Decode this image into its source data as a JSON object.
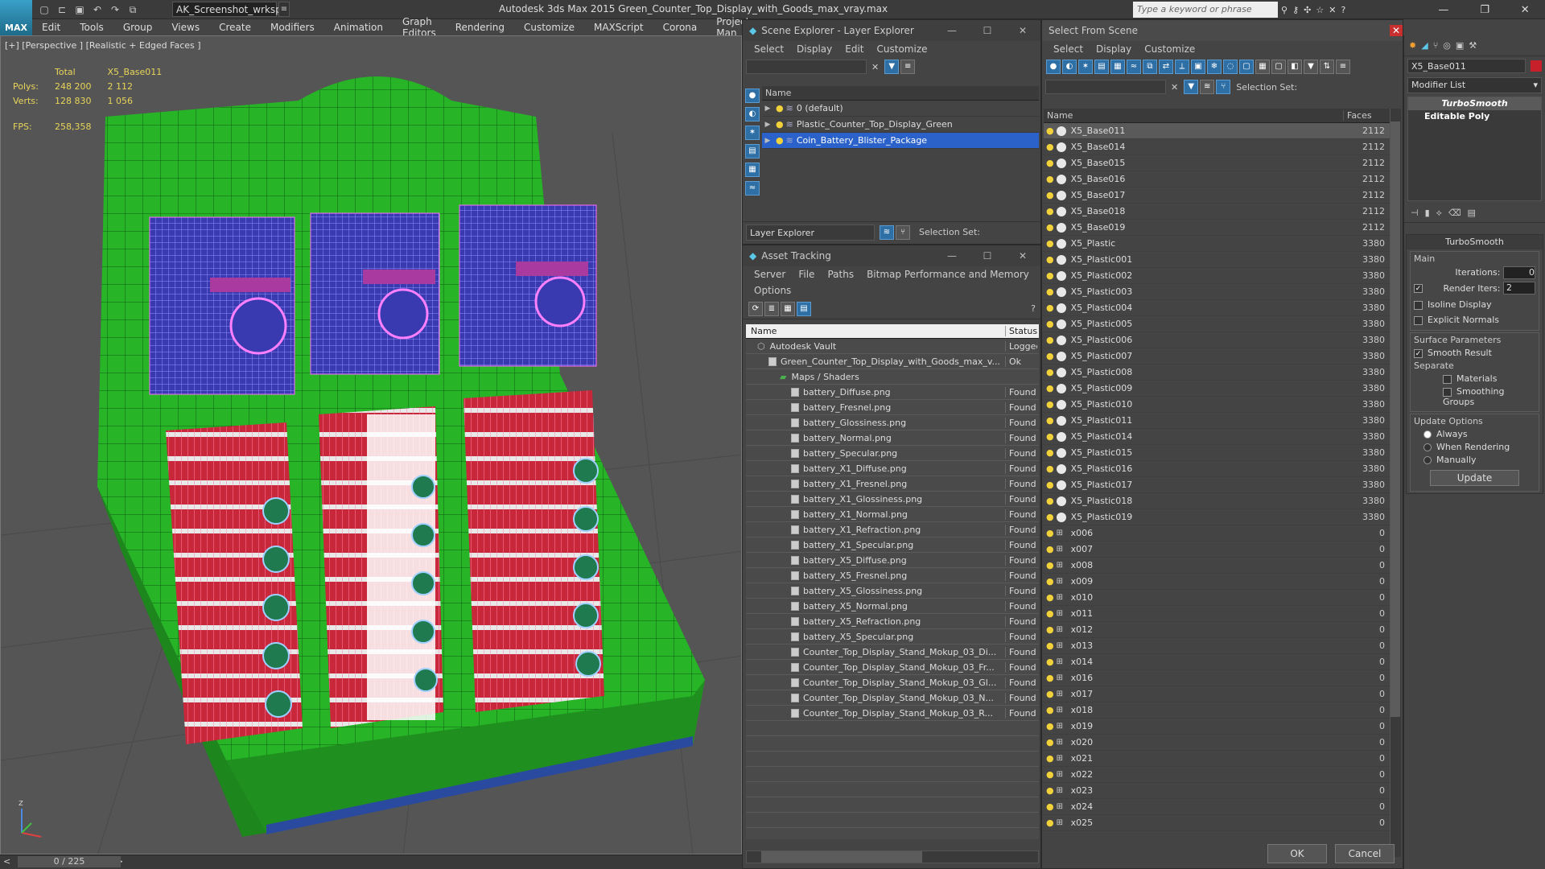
{
  "app": {
    "title": "Autodesk 3ds Max  2015     Green_Counter_Top_Display_with_Goods_max_vray.max",
    "workspace": "AK_Screenshot_wrksp",
    "logo_text": "MAX",
    "search_placeholder": "Type a keyword or phrase"
  },
  "menu": [
    "Edit",
    "Tools",
    "Group",
    "Views",
    "Create",
    "Modifiers",
    "Animation",
    "Graph Editors",
    "Rendering",
    "Customize",
    "MAXScript",
    "Corona",
    "Project Man"
  ],
  "viewport": {
    "label": "[+] [Perspective ] [Realistic + Edged Faces ]",
    "stats": {
      "total_label": "Total",
      "object_label": "X5_Base011",
      "polys_label": "Polys:",
      "polys_total": "248 200",
      "polys_obj": "2 112",
      "verts_label": "Verts:",
      "verts_total": "128 830",
      "verts_obj": "1 056",
      "fps_label": "FPS:",
      "fps_value": "258,358"
    },
    "timeline": "0 / 225",
    "axis_z": "z"
  },
  "scene_explorer": {
    "title": "Scene Explorer - Layer Explorer",
    "menu": [
      "Select",
      "Display",
      "Edit",
      "Customize"
    ],
    "col_name": "Name",
    "layers": [
      {
        "name": "0 (default)",
        "selected": false
      },
      {
        "name": "Plastic_Counter_Top_Display_Green",
        "selected": false
      },
      {
        "name": "Coin_Battery_Blister_Package",
        "selected": true
      }
    ],
    "explorer_dropdown": "Layer Explorer",
    "selection_set_label": "Selection Set:"
  },
  "asset_tracking": {
    "title": "Asset Tracking",
    "menu": [
      "Server",
      "File",
      "Paths",
      "Bitmap Performance and Memory"
    ],
    "menu2": "Options",
    "col_name": "Name",
    "col_status": "Status",
    "rows": [
      {
        "name": "Autodesk Vault",
        "status": "Logged",
        "indent": 1,
        "type": "vault"
      },
      {
        "name": "Green_Counter_Top_Display_with_Goods_max_v...",
        "status": "Ok",
        "indent": 2,
        "type": "file"
      },
      {
        "name": "Maps / Shaders",
        "status": "",
        "indent": 3,
        "type": "folder"
      },
      {
        "name": "battery_Diffuse.png",
        "status": "Found",
        "indent": 4,
        "type": "map"
      },
      {
        "name": "battery_Fresnel.png",
        "status": "Found",
        "indent": 4,
        "type": "map"
      },
      {
        "name": "battery_Glossiness.png",
        "status": "Found",
        "indent": 4,
        "type": "map"
      },
      {
        "name": "battery_Normal.png",
        "status": "Found",
        "indent": 4,
        "type": "map"
      },
      {
        "name": "battery_Specular.png",
        "status": "Found",
        "indent": 4,
        "type": "map"
      },
      {
        "name": "battery_X1_Diffuse.png",
        "status": "Found",
        "indent": 4,
        "type": "map"
      },
      {
        "name": "battery_X1_Fresnel.png",
        "status": "Found",
        "indent": 4,
        "type": "map"
      },
      {
        "name": "battery_X1_Glossiness.png",
        "status": "Found",
        "indent": 4,
        "type": "map"
      },
      {
        "name": "battery_X1_Normal.png",
        "status": "Found",
        "indent": 4,
        "type": "map"
      },
      {
        "name": "battery_X1_Refraction.png",
        "status": "Found",
        "indent": 4,
        "type": "map"
      },
      {
        "name": "battery_X1_Specular.png",
        "status": "Found",
        "indent": 4,
        "type": "map"
      },
      {
        "name": "battery_X5_Diffuse.png",
        "status": "Found",
        "indent": 4,
        "type": "map"
      },
      {
        "name": "battery_X5_Fresnel.png",
        "status": "Found",
        "indent": 4,
        "type": "map"
      },
      {
        "name": "battery_X5_Glossiness.png",
        "status": "Found",
        "indent": 4,
        "type": "map"
      },
      {
        "name": "battery_X5_Normal.png",
        "status": "Found",
        "indent": 4,
        "type": "map"
      },
      {
        "name": "battery_X5_Refraction.png",
        "status": "Found",
        "indent": 4,
        "type": "map"
      },
      {
        "name": "battery_X5_Specular.png",
        "status": "Found",
        "indent": 4,
        "type": "map"
      },
      {
        "name": "Counter_Top_Display_Stand_Mokup_03_Di...",
        "status": "Found",
        "indent": 4,
        "type": "map"
      },
      {
        "name": "Counter_Top_Display_Stand_Mokup_03_Fr...",
        "status": "Found",
        "indent": 4,
        "type": "map"
      },
      {
        "name": "Counter_Top_Display_Stand_Mokup_03_Gl...",
        "status": "Found",
        "indent": 4,
        "type": "map"
      },
      {
        "name": "Counter_Top_Display_Stand_Mokup_03_N...",
        "status": "Found",
        "indent": 4,
        "type": "map"
      },
      {
        "name": "Counter_Top_Display_Stand_Mokup_03_R...",
        "status": "Found",
        "indent": 4,
        "type": "map"
      }
    ]
  },
  "select_from_scene": {
    "title": "Select From Scene",
    "menu": [
      "Select",
      "Display",
      "Customize"
    ],
    "selection_set_label": "Selection Set:",
    "col_name": "Name",
    "col_faces": "Faces",
    "ok": "OK",
    "cancel": "Cancel",
    "rows": [
      {
        "name": "X5_Base011",
        "faces": "2112",
        "kind": "geo",
        "selected": true
      },
      {
        "name": "X5_Base014",
        "faces": "2112",
        "kind": "geo"
      },
      {
        "name": "X5_Base015",
        "faces": "2112",
        "kind": "geo"
      },
      {
        "name": "X5_Base016",
        "faces": "2112",
        "kind": "geo"
      },
      {
        "name": "X5_Base017",
        "faces": "2112",
        "kind": "geo"
      },
      {
        "name": "X5_Base018",
        "faces": "2112",
        "kind": "geo"
      },
      {
        "name": "X5_Base019",
        "faces": "2112",
        "kind": "geo"
      },
      {
        "name": "X5_Plastic",
        "faces": "3380",
        "kind": "geo"
      },
      {
        "name": "X5_Plastic001",
        "faces": "3380",
        "kind": "geo"
      },
      {
        "name": "X5_Plastic002",
        "faces": "3380",
        "kind": "geo"
      },
      {
        "name": "X5_Plastic003",
        "faces": "3380",
        "kind": "geo"
      },
      {
        "name": "X5_Plastic004",
        "faces": "3380",
        "kind": "geo"
      },
      {
        "name": "X5_Plastic005",
        "faces": "3380",
        "kind": "geo"
      },
      {
        "name": "X5_Plastic006",
        "faces": "3380",
        "kind": "geo"
      },
      {
        "name": "X5_Plastic007",
        "faces": "3380",
        "kind": "geo"
      },
      {
        "name": "X5_Plastic008",
        "faces": "3380",
        "kind": "geo"
      },
      {
        "name": "X5_Plastic009",
        "faces": "3380",
        "kind": "geo"
      },
      {
        "name": "X5_Plastic010",
        "faces": "3380",
        "kind": "geo"
      },
      {
        "name": "X5_Plastic011",
        "faces": "3380",
        "kind": "geo"
      },
      {
        "name": "X5_Plastic014",
        "faces": "3380",
        "kind": "geo"
      },
      {
        "name": "X5_Plastic015",
        "faces": "3380",
        "kind": "geo"
      },
      {
        "name": "X5_Plastic016",
        "faces": "3380",
        "kind": "geo"
      },
      {
        "name": "X5_Plastic017",
        "faces": "3380",
        "kind": "geo"
      },
      {
        "name": "X5_Plastic018",
        "faces": "3380",
        "kind": "geo"
      },
      {
        "name": "X5_Plastic019",
        "faces": "3380",
        "kind": "geo"
      },
      {
        "name": "x006",
        "faces": "0",
        "kind": "helper"
      },
      {
        "name": "x007",
        "faces": "0",
        "kind": "helper"
      },
      {
        "name": "x008",
        "faces": "0",
        "kind": "helper"
      },
      {
        "name": "x009",
        "faces": "0",
        "kind": "helper"
      },
      {
        "name": "x010",
        "faces": "0",
        "kind": "helper"
      },
      {
        "name": "x011",
        "faces": "0",
        "kind": "helper"
      },
      {
        "name": "x012",
        "faces": "0",
        "kind": "helper"
      },
      {
        "name": "x013",
        "faces": "0",
        "kind": "helper"
      },
      {
        "name": "x014",
        "faces": "0",
        "kind": "helper"
      },
      {
        "name": "x016",
        "faces": "0",
        "kind": "helper"
      },
      {
        "name": "x017",
        "faces": "0",
        "kind": "helper"
      },
      {
        "name": "x018",
        "faces": "0",
        "kind": "helper"
      },
      {
        "name": "x019",
        "faces": "0",
        "kind": "helper"
      },
      {
        "name": "x020",
        "faces": "0",
        "kind": "helper"
      },
      {
        "name": "x021",
        "faces": "0",
        "kind": "helper"
      },
      {
        "name": "x022",
        "faces": "0",
        "kind": "helper"
      },
      {
        "name": "x023",
        "faces": "0",
        "kind": "helper"
      },
      {
        "name": "x024",
        "faces": "0",
        "kind": "helper"
      },
      {
        "name": "x025",
        "faces": "0",
        "kind": "helper"
      }
    ]
  },
  "command_panel": {
    "object_name": "X5_Base011",
    "modifier_list": "Modifier List",
    "stack": [
      "TurboSmooth",
      "Editable Poly"
    ],
    "rollout_title": "TurboSmooth",
    "main_label": "Main",
    "iterations_label": "Iterations:",
    "iterations": "0",
    "render_iters_label": "Render Iters:",
    "render_iters": "2",
    "isoline": "Isoline Display",
    "explicit": "Explicit Normals",
    "surface_label": "Surface Parameters",
    "smooth_result": "Smooth Result",
    "separate_label": "Separate",
    "materials": "Materials",
    "smoothing_groups": "Smoothing Groups",
    "update_options": "Update Options",
    "always": "Always",
    "when_rendering": "When Rendering",
    "manually": "Manually",
    "update_btn": "Update",
    "color_swatch": "#c8202a"
  }
}
